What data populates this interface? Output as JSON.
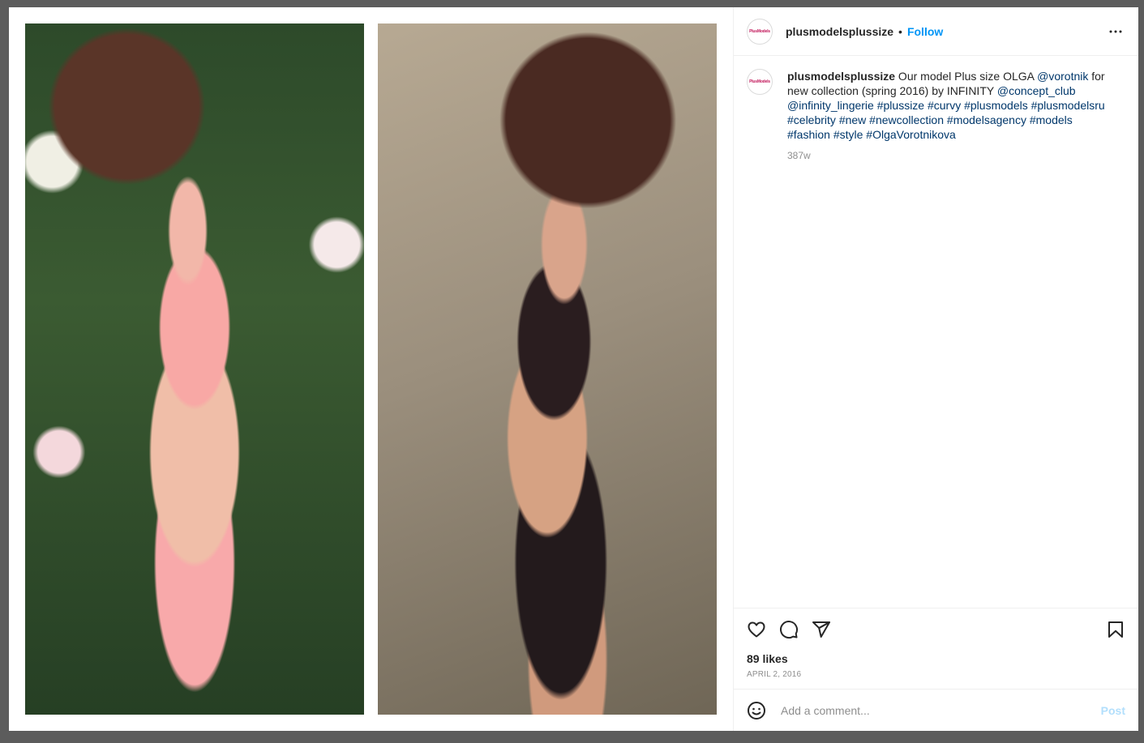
{
  "post": {
    "username": "plusmodelsplussize",
    "follow_label": "Follow",
    "separator": "•",
    "avatar_text": "PlusModels",
    "caption": {
      "username": "plusmodelsplussize",
      "text1": " Our model Plus size OLGA ",
      "mention1": "@vorotnik",
      "text2": " for new collection (spring 2016) by INFINITY ",
      "mention2": "@concept_club",
      "mention3": "@infinity_lingerie",
      "tags": [
        "#plussize",
        "#curvy",
        "#plusmodels",
        "#plusmodelsru",
        "#celebrity",
        "#new",
        "#newcollection",
        "#modelsagency",
        "#models",
        "#fashion",
        "#style",
        "#OlgaVorotnikova"
      ],
      "age": "387w"
    },
    "likes": "89 likes",
    "date": "APRIL 2, 2016"
  },
  "comment": {
    "placeholder": "Add a comment...",
    "post_label": "Post"
  },
  "icons": {
    "more": "more-options-icon",
    "like": "heart-icon",
    "comment": "comment-icon",
    "share": "share-icon",
    "save": "bookmark-icon",
    "emoji": "emoji-icon"
  }
}
